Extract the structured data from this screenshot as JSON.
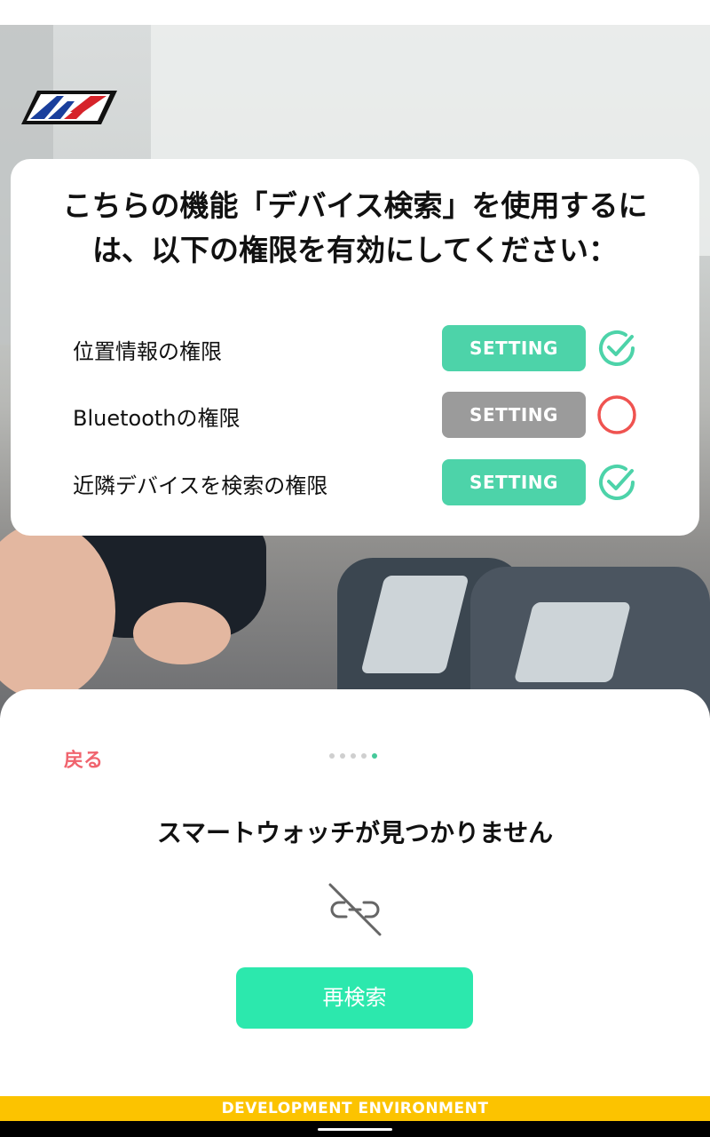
{
  "card": {
    "title": "こちらの機能「デバイス検索」を使用するには、以下の権限を有効にしてください：",
    "permissions": [
      {
        "label": "位置情報の権限",
        "button": "SETTING",
        "status": "granted",
        "status_icon": "check-circle-icon"
      },
      {
        "label": "Bluetoothの権限",
        "button": "SETTING",
        "status": "denied",
        "status_icon": "empty-circle-icon"
      },
      {
        "label": "近隣デバイスを検索の権限",
        "button": "SETTING",
        "status": "granted",
        "status_icon": "check-circle-icon"
      }
    ]
  },
  "sheet": {
    "back_label": "戻る",
    "page_dots": {
      "total": 5,
      "active_index": 4
    },
    "message": "スマートウォッチが見つかりません",
    "icon": "unlink-icon",
    "research_button": "再検索"
  },
  "banner": {
    "text": "DEVELOPMENT ENVIRONMENT"
  },
  "colors": {
    "accent_green": "#4dd3a9",
    "button_green": "#2ce8ad",
    "disabled_gray": "#9b9b9b",
    "error_red": "#ef5350",
    "back_red": "#f0646e",
    "banner_yellow": "#fcc300"
  }
}
